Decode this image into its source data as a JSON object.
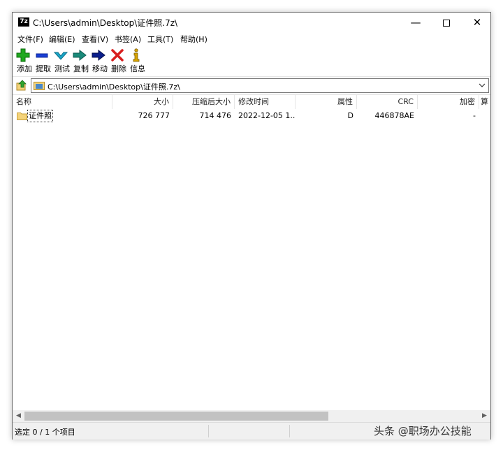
{
  "window": {
    "app_icon_text": "7z",
    "title": "C:\\Users\\admin\\Desktop\\证件照.7z\\"
  },
  "menu": [
    "文件(F)",
    "编辑(E)",
    "查看(V)",
    "书签(A)",
    "工具(T)",
    "帮助(H)"
  ],
  "toolbar": {
    "add": "添加",
    "extract": "提取",
    "test": "测试",
    "copy": "复制",
    "move": "移动",
    "delete": "删除",
    "info": "信息"
  },
  "address": {
    "value": "C:\\Users\\admin\\Desktop\\证件照.7z\\"
  },
  "columns": {
    "name": "名称",
    "size": "大小",
    "packed": "压缩后大小",
    "modified": "修改时间",
    "attributes": "属性",
    "crc": "CRC",
    "encrypted": "加密",
    "method": "算"
  },
  "rows": [
    {
      "name": "证件照",
      "size": "726 777",
      "packed": "714 476",
      "modified": "2022-12-05 1...",
      "attributes": "D",
      "crc": "446878AE",
      "encrypted": "-"
    }
  ],
  "status": {
    "selection": "选定 0 / 1 个项目"
  },
  "watermark": "头条 @职场办公技能",
  "colors": {
    "add": "#1fa81f",
    "extract": "#1a3fd6",
    "test": "#1aa6c9",
    "copy": "#1a8a7a",
    "move": "#0a1e8c",
    "delete": "#d81e1e",
    "info": "#d8a400",
    "folder": "#f4d37a"
  }
}
